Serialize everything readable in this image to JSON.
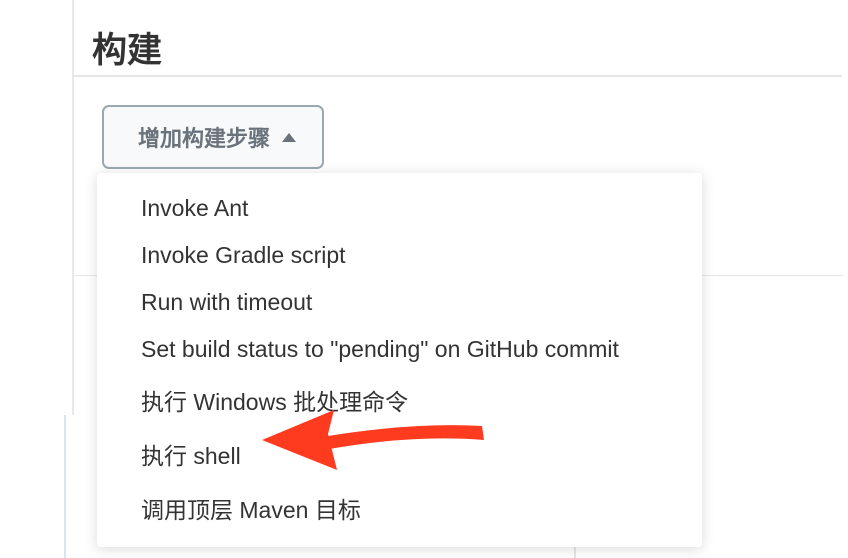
{
  "section": {
    "title": "构建"
  },
  "dropdown": {
    "button_label": "增加构建步骤",
    "items": [
      "Invoke Ant",
      "Invoke Gradle script",
      "Run with timeout",
      "Set build status to \"pending\" on GitHub commit",
      "执行 Windows 批处理命令",
      "执行 shell",
      "调用顶层 Maven 目标"
    ]
  },
  "annotation": {
    "arrow_color": "#ff3b1f"
  }
}
